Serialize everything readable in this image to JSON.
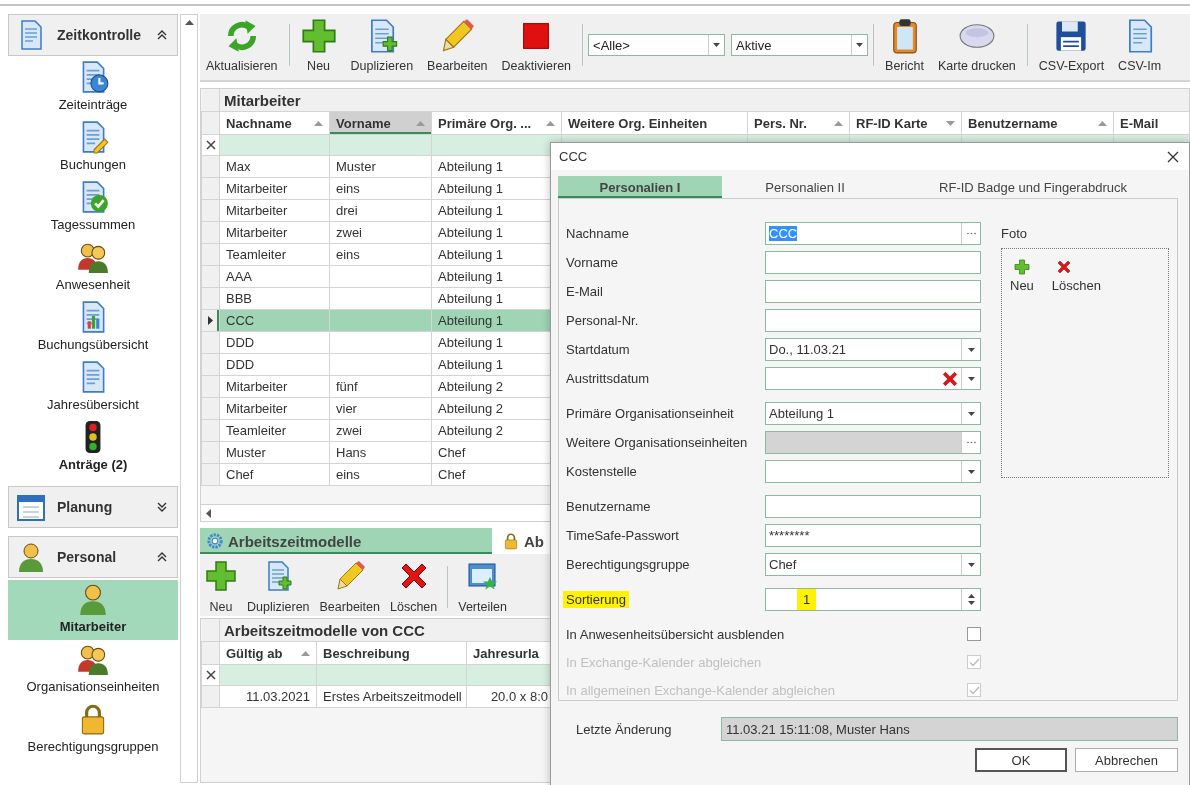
{
  "sidebar": {
    "groups": [
      {
        "title": "Zeitkontrolle",
        "expanded": true,
        "items": [
          {
            "label": "Zeiteinträge",
            "selected": false,
            "has_pending": false
          },
          {
            "label": "Buchungen",
            "selected": false,
            "has_pending": false
          },
          {
            "label": "Tagessummen",
            "selected": false,
            "has_pending": false
          },
          {
            "label": "Anwesenheit",
            "selected": false,
            "has_pending": false
          },
          {
            "label": "Buchungsübersicht",
            "selected": false,
            "has_pending": false
          },
          {
            "label": "Jahresübersicht",
            "selected": false,
            "has_pending": false
          },
          {
            "label": "Anträge (2)",
            "selected": false,
            "has_pending": true
          }
        ]
      },
      {
        "title": "Planung",
        "expanded": false
      },
      {
        "title": "Personal",
        "expanded": true,
        "items": [
          {
            "label": "Mitarbeiter",
            "selected": true
          },
          {
            "label": "Organisationseinheiten",
            "selected": false,
            "has_pending": false
          },
          {
            "label": "Berechtigungsgruppen",
            "selected": false,
            "has_pending": false
          }
        ]
      }
    ]
  },
  "toolbar": [
    [
      {
        "kind": "button",
        "label": "Aktualisieren"
      }
    ],
    [
      {
        "kind": "button",
        "label": "Neu"
      },
      {
        "kind": "button",
        "label": "Duplizieren"
      },
      {
        "kind": "button",
        "label": "Bearbeiten"
      },
      {
        "kind": "button",
        "label": "Deaktivieren"
      }
    ],
    [
      {
        "kind": "combo",
        "value": "<Alle>"
      },
      {
        "kind": "combo",
        "value": "Aktive"
      }
    ],
    [
      {
        "kind": "button",
        "label": "Bericht"
      },
      {
        "kind": "button",
        "label": "Karte drucken"
      }
    ],
    [
      {
        "kind": "button",
        "label": "CSV-Export"
      },
      {
        "kind": "button",
        "label": "CSV-Im"
      }
    ]
  ],
  "employees": {
    "title": "Mitarbeiter",
    "columns": [
      {
        "label": "Nachname",
        "sorted": true,
        "descending": false,
        "selected": false
      },
      {
        "label": "Vorname",
        "sorted": true,
        "descending": false,
        "selected": true
      },
      {
        "label": "Primäre Org. ...",
        "sorted": true,
        "descending": false,
        "selected": false
      },
      {
        "label": "Weitere Org. Einheiten",
        "sorted": false,
        "selected": false
      },
      {
        "label": "Pers. Nr.",
        "sorted": true,
        "descending": false,
        "selected": false
      },
      {
        "label": "RF-ID Karte",
        "sorted": true,
        "descending": true,
        "selected": false
      },
      {
        "label": "Benutzername",
        "sorted": true,
        "descending": false,
        "selected": false
      },
      {
        "label": "E-Mail",
        "sorted": false,
        "selected": false
      }
    ],
    "rows": [
      {
        "last_name": "Max",
        "first_name": "Muster",
        "primary_org": "Abteilung 1",
        "selected": false
      },
      {
        "last_name": "Mitarbeiter",
        "first_name": "eins",
        "primary_org": "Abteilung 1",
        "selected": false
      },
      {
        "last_name": "Mitarbeiter",
        "first_name": "drei",
        "primary_org": "Abteilung 1",
        "selected": false
      },
      {
        "last_name": "Mitarbeiter",
        "first_name": "zwei",
        "primary_org": "Abteilung 1",
        "selected": false
      },
      {
        "last_name": "Teamleiter",
        "first_name": "eins",
        "primary_org": "Abteilung 1",
        "selected": false
      },
      {
        "last_name": "AAA",
        "primary_org": "Abteilung 1",
        "selected": false
      },
      {
        "last_name": "BBB",
        "primary_org": "Abteilung 1",
        "selected": false
      },
      {
        "last_name": "CCC",
        "primary_org": "Abteilung 1",
        "selected": true
      },
      {
        "last_name": "DDD",
        "primary_org": "Abteilung 1",
        "selected": false
      },
      {
        "last_name": "DDD",
        "primary_org": "Abteilung 1",
        "selected": false
      },
      {
        "last_name": "Mitarbeiter",
        "first_name": "fünf",
        "primary_org": "Abteilung 2",
        "selected": false
      },
      {
        "last_name": "Mitarbeiter",
        "first_name": "vier",
        "primary_org": "Abteilung 2",
        "selected": false
      },
      {
        "last_name": "Teamleiter",
        "first_name": "zwei",
        "primary_org": "Abteilung 2",
        "selected": false
      },
      {
        "last_name": "Muster",
        "first_name": "Hans",
        "primary_org": "Chef",
        "selected": false
      },
      {
        "last_name": "Chef",
        "first_name": "eins",
        "primary_org": "Chef",
        "selected": false
      }
    ]
  },
  "models_panel": {
    "tabs": [
      {
        "label": "Arbeitszeitmodelle",
        "selected": true
      },
      {
        "label": "Ab",
        "selected": false
      }
    ],
    "toolbar": [
      "Neu",
      "Duplizieren",
      "Bearbeiten",
      "Löschen",
      "Verteilen"
    ],
    "grid": {
      "title": "Arbeitszeitmodelle von CCC",
      "columns": [
        {
          "label": "Gültig ab",
          "sorted": true,
          "descending": false,
          "selected": false
        },
        {
          "label": "Beschreibung",
          "sorted": false,
          "selected": false
        },
        {
          "label": "Jahresurla",
          "sorted": false,
          "selected": false
        }
      ],
      "rows": [
        {
          "valid_from": "11.03.2021",
          "description": "Erstes Arbeitszeitmodell",
          "annual_leave": "20.0 x 8:0",
          "selected": false
        }
      ]
    }
  },
  "dialog": {
    "title": "CCC",
    "tabs": [
      {
        "label": "Personalien I",
        "selected": true
      },
      {
        "label": "Personalien II",
        "selected": false
      },
      {
        "label": "RF-ID Badge und Fingerabdruck",
        "selected": false
      }
    ],
    "field_groups": [
      [
        {
          "label": "Nachname",
          "kind": "ellipsis",
          "value": "CCC",
          "value_selected": true,
          "disabled": false,
          "highlighted": false
        },
        {
          "label": "Vorname",
          "kind": "text",
          "disabled": false,
          "highlighted": false
        },
        {
          "label": "E-Mail",
          "kind": "text",
          "disabled": false,
          "highlighted": false
        },
        {
          "label": "Personal-Nr.",
          "kind": "text",
          "disabled": false,
          "highlighted": false
        },
        {
          "label": "Startdatum",
          "kind": "dropdown",
          "value": "Do., 11.03.21",
          "value_selected": false,
          "disabled": false,
          "highlighted": false
        },
        {
          "label": "Austrittsdatum",
          "kind": "clearable-dropdown",
          "disabled": false,
          "highlighted": false
        }
      ],
      [
        {
          "label": "Primäre Organisationseinheit",
          "kind": "dropdown",
          "value": "Abteilung 1",
          "value_selected": false,
          "disabled": false,
          "highlighted": false
        },
        {
          "label": "Weitere Organisationseinheiten",
          "kind": "ellipsis",
          "disabled": true,
          "highlighted": false
        },
        {
          "label": "Kostenstelle",
          "kind": "dropdown",
          "disabled": false,
          "highlighted": false
        }
      ],
      [
        {
          "label": "Benutzername",
          "kind": "text",
          "disabled": false,
          "highlighted": false
        },
        {
          "label": "TimeSafe-Passwort",
          "kind": "text",
          "value": "********",
          "value_selected": false,
          "disabled": false,
          "highlighted": false
        },
        {
          "label": "Berechtigungsgruppe",
          "kind": "dropdown",
          "value": "Chef",
          "value_selected": false,
          "disabled": false,
          "highlighted": false
        }
      ],
      [
        {
          "label": "Sortierung",
          "kind": "spin",
          "value": "1",
          "value_selected": false,
          "disabled": false,
          "highlighted": true
        }
      ]
    ],
    "photo": {
      "label": "Foto",
      "buttons": [
        "Neu",
        "Löschen"
      ]
    },
    "checkboxes": [
      {
        "label": "In Anwesenheitsübersicht ausblenden",
        "checked": false,
        "disabled": false
      },
      {
        "label": "In Exchange-Kalender abgleichen",
        "checked": true,
        "disabled": true
      },
      {
        "label": "In allgemeinen Exchange-Kalender abgleichen",
        "checked": true,
        "disabled": true
      }
    ],
    "last_change": {
      "label": "Letzte Änderung",
      "value": "11.03.21 15:11:08, Muster Hans"
    },
    "buttons": [
      {
        "label": "OK",
        "default": true
      },
      {
        "label": "Abbrechen",
        "default": false
      }
    ]
  }
}
